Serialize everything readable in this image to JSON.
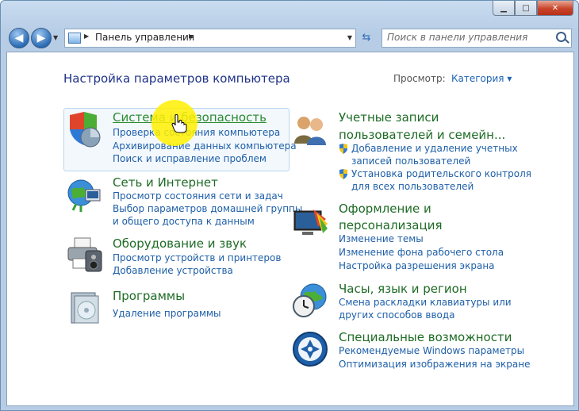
{
  "window": {
    "caption_min": "▁",
    "caption_max": "□",
    "caption_close": "✕"
  },
  "navbar": {
    "address_crumb": "Панель управления",
    "search_placeholder": "Поиск в панели управления"
  },
  "header": {
    "title": "Настройка параметров компьютера",
    "view_label": "Просмотр:",
    "view_value": "Категория ▾"
  },
  "categories": [
    {
      "title": "Система и безопасность",
      "icon": "security-shield-icon",
      "links": [
        "Проверка состояния компьютера",
        "Архивирование данных компьютера",
        "Поиск и исправление проблем"
      ]
    },
    {
      "title": "Сеть и Интернет",
      "icon": "network-globe-icon",
      "links": [
        "Просмотр состояния сети и задач",
        "Выбор параметров домашней группы",
        "и общего доступа к данным"
      ]
    },
    {
      "title": "Оборудование и звук",
      "icon": "printer-icon",
      "links": [
        "Просмотр устройств и принтеров",
        "Добавление устройства"
      ]
    },
    {
      "title": "Программы",
      "icon": "programs-icon",
      "links": [
        "Удаление программы"
      ]
    },
    {
      "title_lines": [
        "Учетные записи",
        "пользователей и семейн..."
      ],
      "icon": "users-icon",
      "links": [
        "Добавление и удаление учетных",
        "записей пользователей",
        "Установка родительского контроля",
        "для всех пользователей"
      ]
    },
    {
      "title_lines": [
        "Оформление и",
        "персонализация"
      ],
      "icon": "appearance-icon",
      "links": [
        "Изменение темы",
        "Изменение фона рабочего стола",
        "Настройка разрешения экрана"
      ]
    },
    {
      "title": "Часы, язык и регион",
      "icon": "clock-globe-icon",
      "links": [
        "Смена раскладки клавиатуры или",
        "других способов ввода"
      ]
    },
    {
      "title": "Специальные возможности",
      "icon": "accessibility-icon",
      "links": [
        "Рекомендуемые Windows параметры",
        "Оптимизация изображения на экране"
      ]
    }
  ]
}
